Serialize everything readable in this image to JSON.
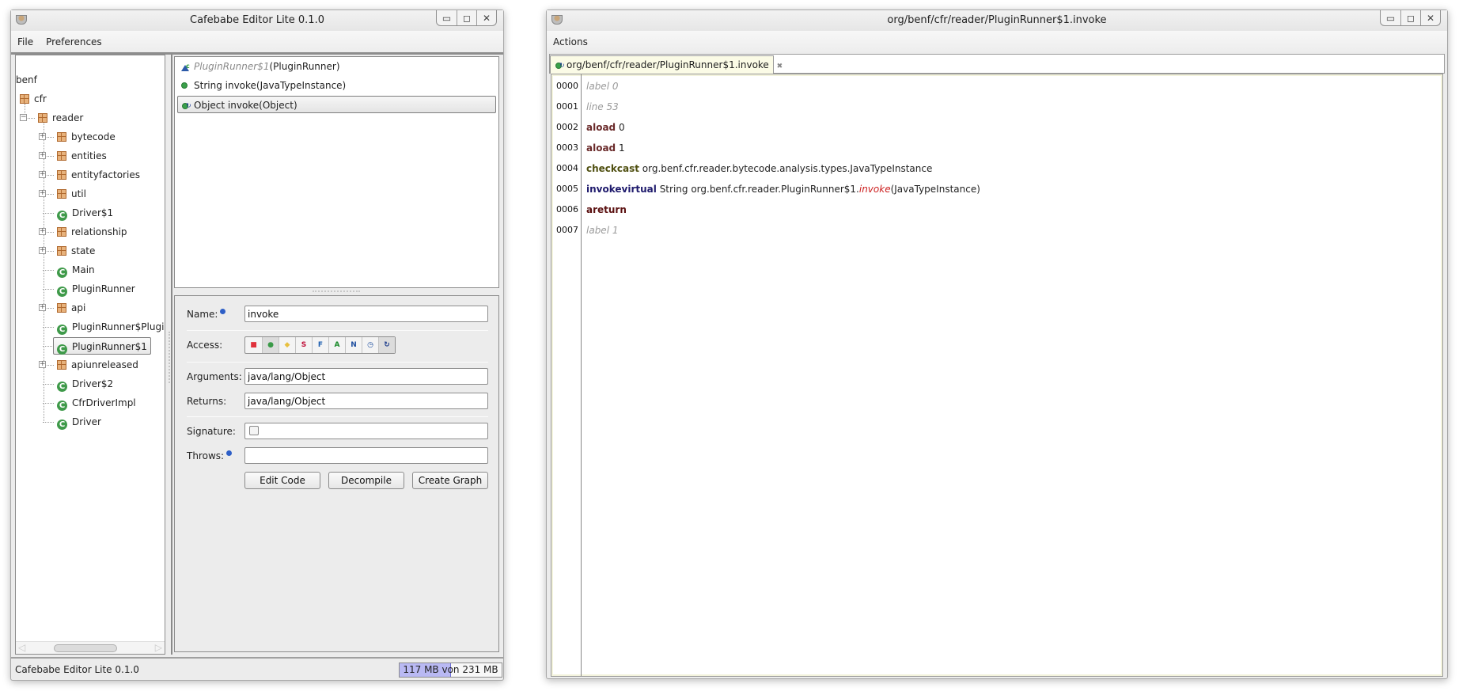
{
  "left_window": {
    "title": "Cafebabe Editor Lite 0.1.0",
    "menu": [
      "File",
      "Preferences"
    ],
    "tree": {
      "root": "benf",
      "items": [
        {
          "label": "cfr",
          "type": "package",
          "level": 0,
          "expander": "none"
        },
        {
          "label": "reader",
          "type": "package",
          "level": 1,
          "expander": "collapse"
        },
        {
          "label": "bytecode",
          "type": "package",
          "level": 2,
          "expander": "expand"
        },
        {
          "label": "entities",
          "type": "package",
          "level": 2,
          "expander": "expand"
        },
        {
          "label": "entityfactories",
          "type": "package",
          "level": 2,
          "expander": "expand"
        },
        {
          "label": "util",
          "type": "package",
          "level": 2,
          "expander": "expand"
        },
        {
          "label": "Driver$1",
          "type": "class",
          "level": 2,
          "expander": "none"
        },
        {
          "label": "relationship",
          "type": "package",
          "level": 2,
          "expander": "expand"
        },
        {
          "label": "state",
          "type": "package",
          "level": 2,
          "expander": "expand"
        },
        {
          "label": "Main",
          "type": "class",
          "level": 2,
          "expander": "none"
        },
        {
          "label": "PluginRunner",
          "type": "class",
          "level": 2,
          "expander": "none"
        },
        {
          "label": "api",
          "type": "package",
          "level": 2,
          "expander": "expand"
        },
        {
          "label": "PluginRunner$PluginGlobal",
          "type": "class",
          "level": 2,
          "expander": "none"
        },
        {
          "label": "PluginRunner$1",
          "type": "class",
          "level": 2,
          "expander": "none",
          "selected": true
        },
        {
          "label": "apiunreleased",
          "type": "package",
          "level": 2,
          "expander": "expand"
        },
        {
          "label": "Driver$2",
          "type": "class",
          "level": 2,
          "expander": "none"
        },
        {
          "label": "CfrDriverImpl",
          "type": "class",
          "level": 2,
          "expander": "none"
        },
        {
          "label": "Driver",
          "type": "class",
          "level": 2,
          "expander": "none"
        }
      ]
    },
    "methods": [
      {
        "name_italic": "PluginRunner$1",
        "rest": "(PluginRunner)",
        "icon": "constructor-icon",
        "selected": false
      },
      {
        "name_italic": "",
        "rest": "String invoke(JavaTypeInstance)",
        "icon": "public-method-icon",
        "selected": false
      },
      {
        "name_italic": "",
        "rest": "Object invoke(Object)",
        "icon": "synthetic-method-icon",
        "selected": true
      }
    ],
    "form": {
      "name_label": "Name:",
      "name_value": "invoke",
      "access_label": "Access:",
      "access_flags": [
        {
          "symbol": "■",
          "meaning": "private",
          "color": "#e0323c",
          "active": false
        },
        {
          "symbol": "●",
          "meaning": "public",
          "color": "#3a9a48",
          "active": true
        },
        {
          "symbol": "◆",
          "meaning": "protected",
          "color": "#e8c040",
          "active": false
        },
        {
          "symbol": "S",
          "meaning": "static",
          "color": "#c0103a",
          "active": false
        },
        {
          "symbol": "F",
          "meaning": "final",
          "color": "#2060b0",
          "active": false
        },
        {
          "symbol": "A",
          "meaning": "abstract",
          "color": "#1a8a2a",
          "active": false
        },
        {
          "symbol": "N",
          "meaning": "native",
          "color": "#2050a0",
          "active": false
        },
        {
          "symbol": "◷",
          "meaning": "synchronized",
          "color": "#2050a0",
          "active": false
        },
        {
          "symbol": "↻",
          "meaning": "synthetic",
          "color": "#1a3a8a",
          "active": true
        }
      ],
      "arguments_label": "Arguments:",
      "arguments_value": "java/lang/Object",
      "returns_label": "Returns:",
      "returns_value": "java/lang/Object",
      "signature_label": "Signature:",
      "signature_checked": false,
      "throws_label": "Throws:",
      "throws_value": "",
      "buttons": [
        "Edit Code",
        "Decompile",
        "Create Graph"
      ]
    },
    "status": {
      "text": "Cafebabe Editor Lite 0.1.0",
      "memory_text": "117 MB von 231 MB",
      "memory_used_mb": 117,
      "memory_total_mb": 231
    }
  },
  "right_window": {
    "title": "org/benf/cfr/reader/PluginRunner$1.invoke",
    "menu": [
      "Actions"
    ],
    "tab": {
      "label": "org/benf/cfr/reader/PluginRunner$1.invoke",
      "close": "✖"
    },
    "code": [
      {
        "num": "0000",
        "kind": "label",
        "op": "label 0",
        "args": ""
      },
      {
        "num": "0001",
        "kind": "label",
        "op": "line 53",
        "args": ""
      },
      {
        "num": "0002",
        "kind": "aload",
        "op": "aload",
        "args": " 0"
      },
      {
        "num": "0003",
        "kind": "aload",
        "op": "aload",
        "args": " 1"
      },
      {
        "num": "0004",
        "kind": "check",
        "op": "checkcast",
        "args": " org.benf.cfr.reader.bytecode.analysis.types.JavaTypeInstance"
      },
      {
        "num": "0005",
        "kind": "invoke",
        "op": "invokevirtual",
        "args": " String org.benf.cfr.reader.PluginRunner$1.",
        "method": "invoke",
        "tail": "(JavaTypeInstance)"
      },
      {
        "num": "0006",
        "kind": "areturn",
        "op": "areturn",
        "args": ""
      },
      {
        "num": "0007",
        "kind": "label",
        "op": "label 1",
        "args": ""
      }
    ]
  }
}
